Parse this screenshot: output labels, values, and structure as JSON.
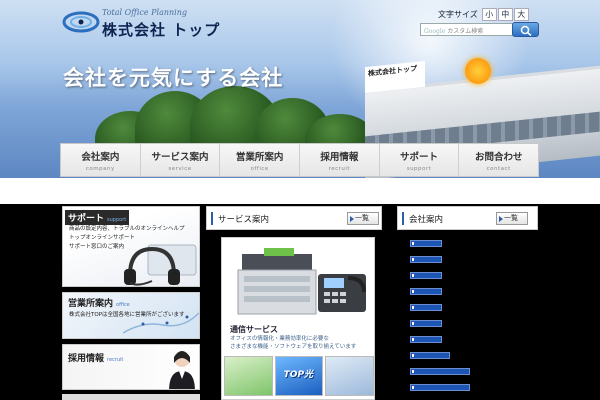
{
  "header": {
    "logo_sub": "Total Office Planning",
    "company_name": "株式会社 トップ",
    "font_size_label": "文字サイズ",
    "font_sizes": [
      "小",
      "中",
      "大"
    ],
    "search_placeholder_brand": "Google",
    "search_placeholder": "カスタム検索",
    "catchphrase": "会社を元気にする会社",
    "building_sign": "株式会社トップ"
  },
  "nav": [
    {
      "label": "会社案内",
      "sub": "company"
    },
    {
      "label": "サービス案内",
      "sub": "service"
    },
    {
      "label": "営業所案内",
      "sub": "office"
    },
    {
      "label": "採用情報",
      "sub": "recruit"
    },
    {
      "label": "サポート",
      "sub": "support"
    },
    {
      "label": "お問合わせ",
      "sub": "contact"
    }
  ],
  "left": {
    "support": {
      "title": "サポート",
      "en": "support",
      "lines": [
        "商品の設定内容、トラブルのオンラインヘルプ",
        "トップオンラインサポート",
        "サポート窓口のご案内"
      ]
    },
    "office": {
      "title": "営業所案内",
      "en": "office",
      "text": "株式会社TOPは全国各地に営業所がございます"
    },
    "recruit": {
      "title": "採用情報",
      "en": "recruit"
    }
  },
  "center": {
    "title": "サービス案内",
    "more": "一覧",
    "service_title": "通信サービス",
    "service_lines": [
      "オフィスの情報化・業務効率化に必要な",
      "さまざまな機能・ソフトウェアを取り揃えています"
    ],
    "thumb_logo": "TOP光"
  },
  "right": {
    "title": "会社案内",
    "more": "一覧",
    "news_bar_count": 10
  },
  "colors": {
    "brand_navy": "#0d2452",
    "link_blue": "#1c55b3",
    "accent_blue": "#2d5fa8"
  }
}
